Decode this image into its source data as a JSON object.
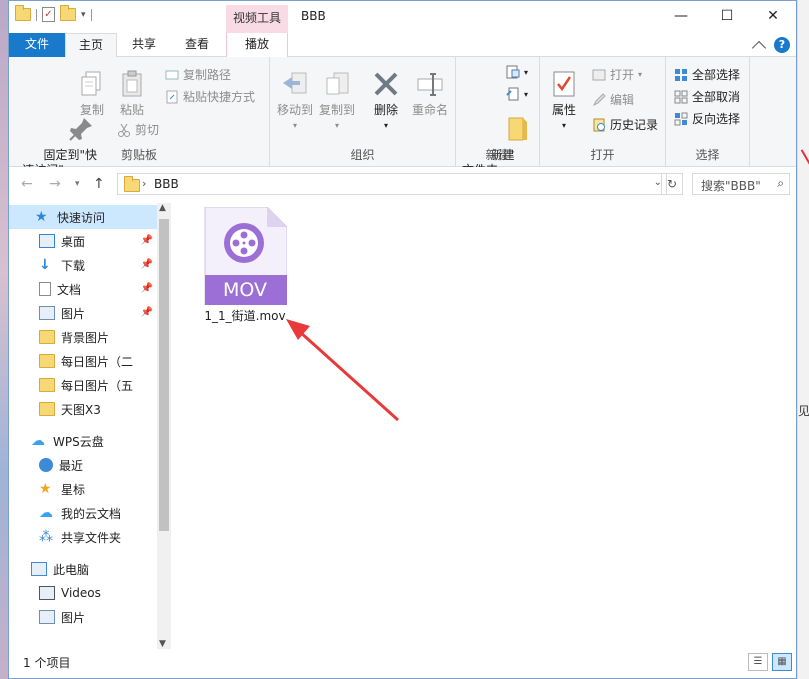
{
  "window": {
    "title": "BBB",
    "contextual_tab_header": "视频工具",
    "controls": {
      "minimize": "—",
      "maximize": "☐",
      "close": "✕"
    }
  },
  "tabs": {
    "file": "文件",
    "home": "主页",
    "share": "共享",
    "view": "查看",
    "play": "播放"
  },
  "ribbon": {
    "clipboard": {
      "label": "剪贴板",
      "pin_quick_access": "固定到\"快\n速访问\"",
      "copy": "复制",
      "paste": "粘贴",
      "copy_path": "复制路径",
      "paste_shortcut": "粘贴快捷方式",
      "cut": "剪切"
    },
    "organize": {
      "label": "组织",
      "move_to": "移动到",
      "copy_to": "复制到",
      "delete": "删除",
      "rename": "重命名"
    },
    "new": {
      "label": "新建",
      "new_folder": "新建\n文件夹"
    },
    "open": {
      "label": "打开",
      "properties": "属性",
      "open": "打开",
      "edit": "编辑",
      "history": "历史记录"
    },
    "select": {
      "label": "选择",
      "select_all": "全部选择",
      "select_none": "全部取消",
      "invert": "反向选择"
    }
  },
  "address": {
    "path": "BBB",
    "search_placeholder": "搜索\"BBB\""
  },
  "nav": {
    "items": [
      {
        "label": "快速访问",
        "icon": "star-icon",
        "pinned": false
      },
      {
        "label": "桌面",
        "icon": "desktop-icon",
        "pinned": true
      },
      {
        "label": "下载",
        "icon": "download-icon",
        "pinned": true
      },
      {
        "label": "文档",
        "icon": "document-icon",
        "pinned": true
      },
      {
        "label": "图片",
        "icon": "pictures-icon",
        "pinned": true
      },
      {
        "label": "背景图片",
        "icon": "folder-icon",
        "pinned": false
      },
      {
        "label": "每日图片（二",
        "icon": "folder-icon",
        "pinned": false
      },
      {
        "label": "每日图片（五",
        "icon": "folder-icon",
        "pinned": false
      },
      {
        "label": "天图X3",
        "icon": "folder-icon",
        "pinned": false
      },
      {
        "label": "WPS云盘",
        "icon": "cloud-icon",
        "pinned": false
      },
      {
        "label": "最近",
        "icon": "clock-icon",
        "pinned": false
      },
      {
        "label": "星标",
        "icon": "star-icon",
        "pinned": false
      },
      {
        "label": "我的云文档",
        "icon": "cloud-icon",
        "pinned": false
      },
      {
        "label": "共享文件夹",
        "icon": "share-icon",
        "pinned": false
      },
      {
        "label": "此电脑",
        "icon": "computer-icon",
        "pinned": false
      },
      {
        "label": "Videos",
        "icon": "video-icon",
        "pinned": false
      },
      {
        "label": "图片",
        "icon": "pictures-icon",
        "pinned": false
      }
    ],
    "pin_glyph": "📌"
  },
  "content": {
    "file": {
      "name": "1_1_街道.mov",
      "badge": "MOV",
      "accent": "#9b6fd6"
    }
  },
  "status": {
    "item_count": "1 个项目"
  },
  "colors": {
    "file_tab": "#1979ca",
    "selection": "#cce8ff",
    "context_tab": "#f9dbe6",
    "annotation_arrow": "#e8393b"
  }
}
